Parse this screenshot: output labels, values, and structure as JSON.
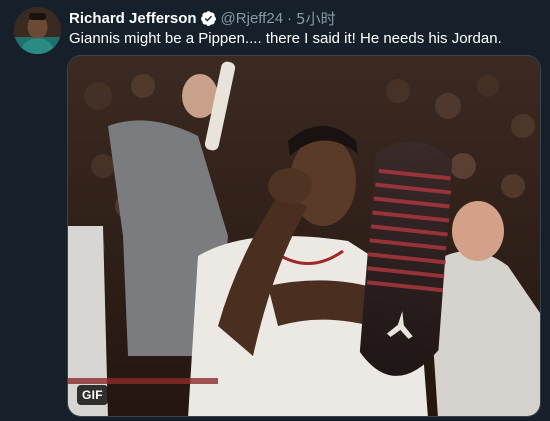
{
  "tweet": {
    "display_name": "Richard Jefferson",
    "handle": "@Rjeff24",
    "separator": "·",
    "time": "5小时",
    "text": "Giannis might be a Pippen.... there I said it! He needs his Jordan.",
    "media": {
      "badge": "GIF"
    }
  },
  "icons": {
    "verified": "verified-badge-icon"
  },
  "colors": {
    "background": "#15202b",
    "secondary_text": "#8899a6",
    "primary_text": "#ffffff",
    "border": "#38444d"
  }
}
